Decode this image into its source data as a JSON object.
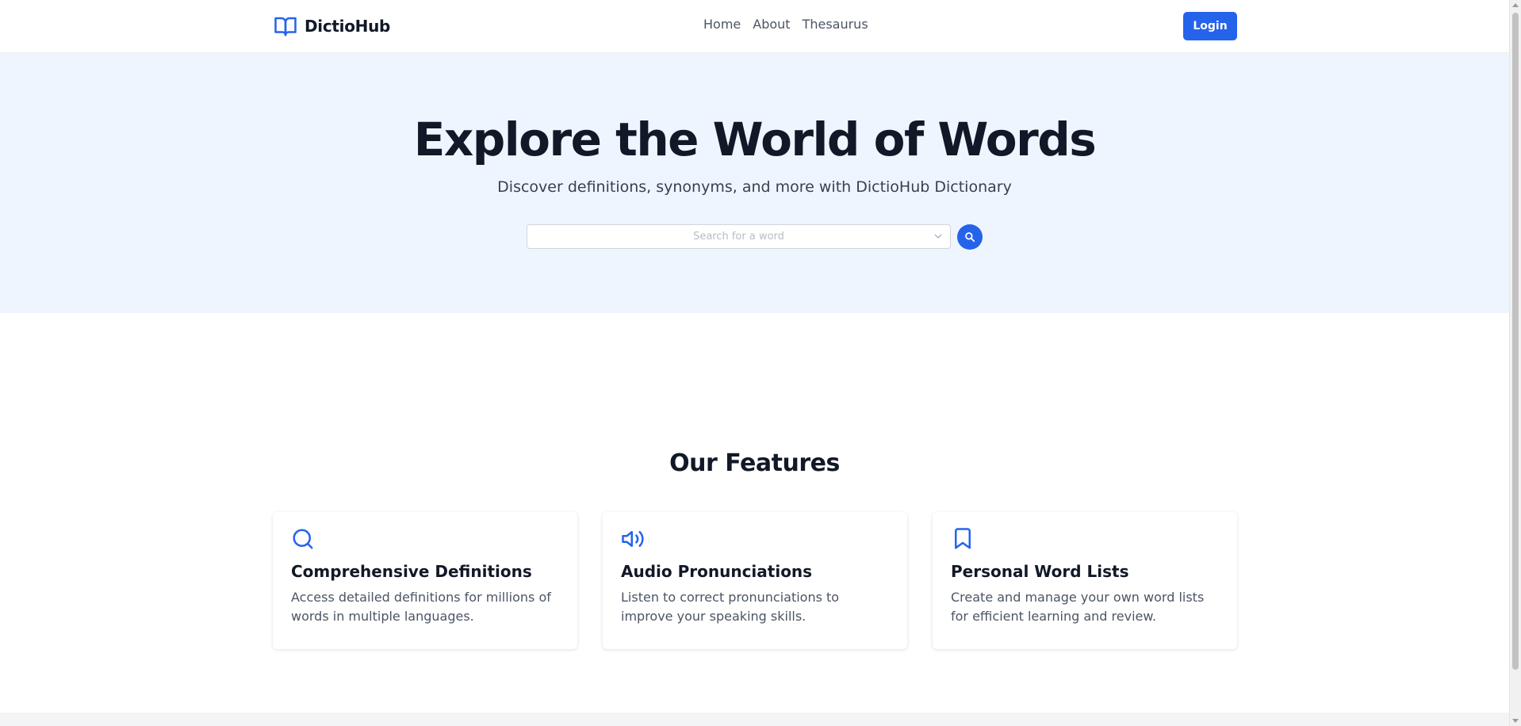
{
  "brand": {
    "name": "DictioHub",
    "icon": "open-book-icon"
  },
  "nav": {
    "links": [
      "Home",
      "About",
      "Thesaurus"
    ],
    "login_label": "Login"
  },
  "hero": {
    "title": "Explore the World of Words",
    "subtitle": "Discover definitions, synonyms, and more with DictioHub Dictionary",
    "search": {
      "placeholder": "Search for a word",
      "value": ""
    }
  },
  "features": {
    "title": "Our Features",
    "items": [
      {
        "icon": "search-icon",
        "title": "Comprehensive Definitions",
        "description": "Access detailed definitions for millions of words in multiple languages."
      },
      {
        "icon": "speaker-icon",
        "title": "Audio Pronunciations",
        "description": "Listen to correct pronunciations to improve your speaking skills."
      },
      {
        "icon": "bookmark-icon",
        "title": "Personal Word Lists",
        "description": "Create and manage your own word lists for efficient learning and review."
      }
    ]
  },
  "colors": {
    "accent": "#2563eb",
    "hero_bg": "#eef5fe",
    "text_dark": "#111827",
    "text_muted": "#4b5563"
  }
}
